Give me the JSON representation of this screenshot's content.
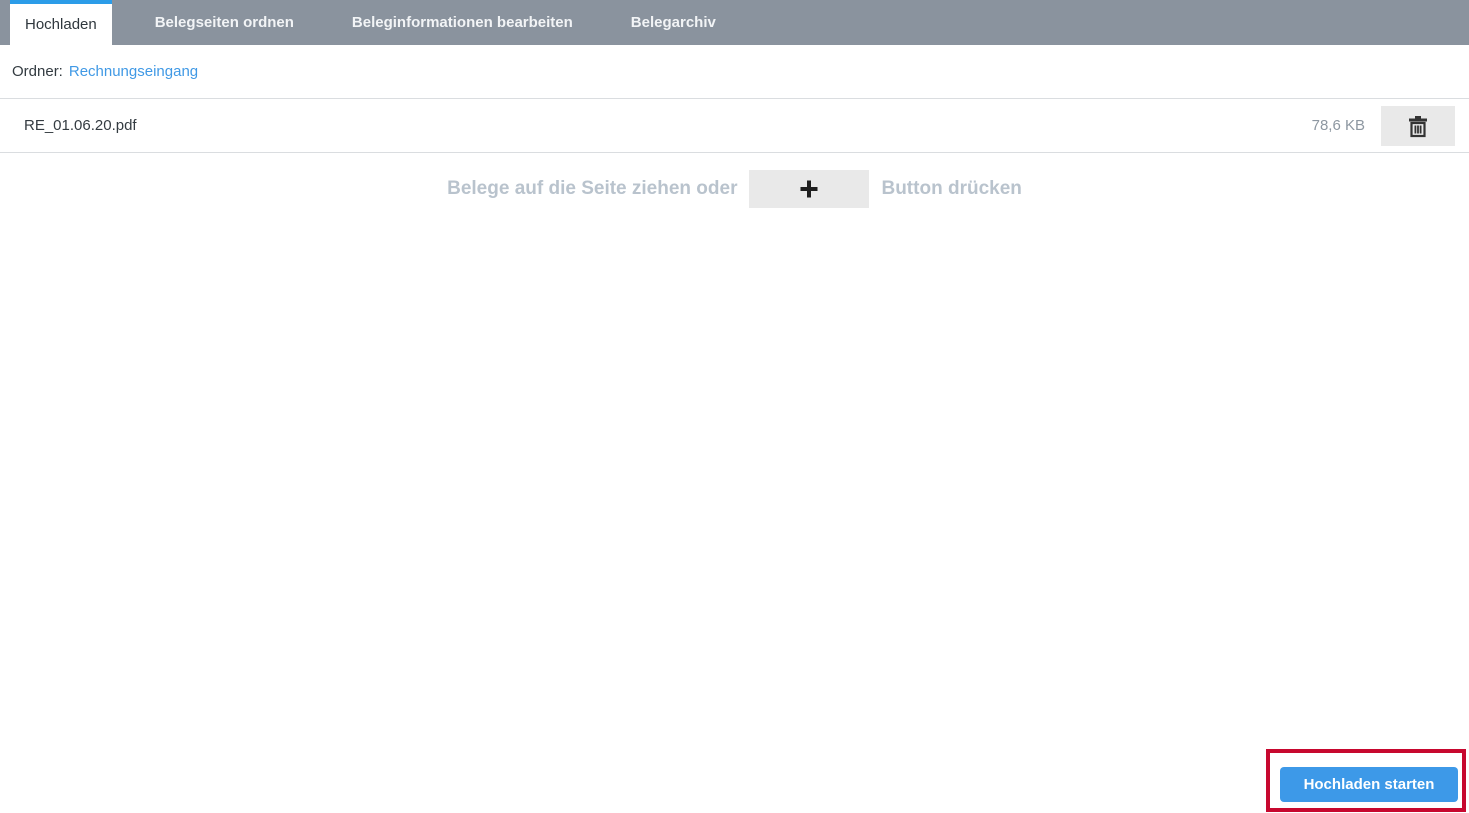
{
  "tab_bar": {
    "tabs": [
      {
        "label": "Hochladen",
        "active": true
      },
      {
        "label": "Belegseiten ordnen",
        "active": false
      },
      {
        "label": "Beleginformationen bearbeiten",
        "active": false
      },
      {
        "label": "Belegarchiv",
        "active": false
      }
    ]
  },
  "folder_bar": {
    "label": "Ordner:",
    "folder_link": "Rechnungseingang"
  },
  "file_list": [
    {
      "name": "RE_01.06.20.pdf",
      "size": "78,6 KB",
      "delete_icon": "trash-icon"
    }
  ],
  "dropzone": {
    "text_before_button": "Belege auf die Seite ziehen oder",
    "plus_icon": "plus-icon",
    "text_after_button": "Button drücken"
  },
  "footer": {
    "start_upload_label": "Hochladen starten"
  },
  "annotation": {
    "shape": "red-highlight-box",
    "color": "#c7082f"
  },
  "colors": {
    "tab_bar_bg": "#8a939e",
    "active_tab_accent": "#2b9ce8",
    "link_blue": "#4099e5",
    "primary_button_bg": "#3d99e8",
    "hint_text": "#b9c3cd",
    "divider": "#dadde0",
    "button_gray_bg": "#e9e9e9",
    "annotation_red": "#c7082f"
  }
}
